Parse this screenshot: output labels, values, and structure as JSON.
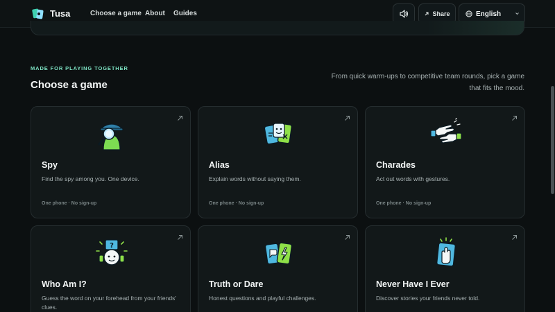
{
  "header": {
    "brand": "Tusa",
    "nav": [
      "Choose a game",
      "About",
      "Guides"
    ],
    "share_label": "Share",
    "language": "English"
  },
  "section": {
    "eyebrow": "MADE FOR PLAYING TOGETHER",
    "title": "Choose a game",
    "description": "From quick warm-ups to competitive team rounds, pick a game that fits the mood."
  },
  "games": [
    {
      "title": "Spy",
      "description": "Find the spy among you. One device.",
      "meta": "One phone · No sign-up",
      "icon": "spy-icon"
    },
    {
      "title": "Alias",
      "description": "Explain words without saying them.",
      "meta": "One phone · No sign-up",
      "icon": "alias-cards-icon"
    },
    {
      "title": "Charades",
      "description": "Act out words with gestures.",
      "meta": "One phone · No sign-up",
      "icon": "charades-hands-icon"
    },
    {
      "title": "Who Am I?",
      "description": "Guess the word on your forehead from your friends' clues.",
      "meta": "",
      "icon": "who-am-i-icon"
    },
    {
      "title": "Truth or Dare",
      "description": "Honest questions and playful challenges.",
      "meta": "",
      "icon": "truth-or-dare-cards-icon"
    },
    {
      "title": "Never Have I Ever",
      "description": "Discover stories your friends never told.",
      "meta": "",
      "icon": "never-have-i-ever-icon"
    }
  ],
  "colors": {
    "background": "#0c1011",
    "card": "#121819",
    "accent": "#7ee3c4"
  }
}
